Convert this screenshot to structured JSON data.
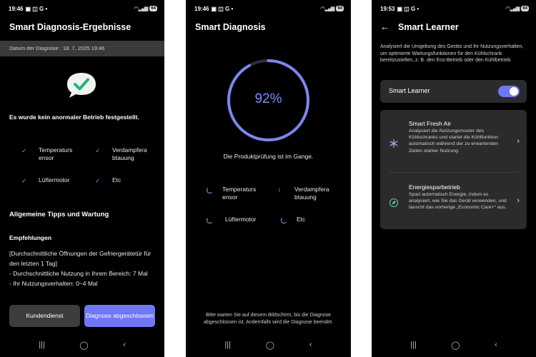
{
  "status": {
    "phone1_time": "19:46",
    "phone2_time": "19:46",
    "phone3_time": "19:53",
    "battery": "64"
  },
  "phone1": {
    "title": "Smart Diagnosis-Ergebnisse",
    "date_line": "Datum der Diagnose : 18. 7. 2025 19:46",
    "status_text": "Es wurde kein anormaler Betrieb festgestellt.",
    "checks": [
      "Temperaturs ensor",
      "Verdampfera btauung",
      "Lüftermotor",
      "Etc"
    ],
    "tips_heading": "Allgemeine Tipps und Wartung",
    "recommendations_heading": "Empfehlungen",
    "body_lines": [
      "[Durchschnittliche Öffnungen der Gefriergerätetür für den letzten 1 Tag]",
      "- Durchschnittliche Nutzung in Ihrem Bereich: 7 Mal",
      "- Ihr Nutzungsverhalten: 0~4 Mal"
    ],
    "btn_service": "Kundendienst",
    "btn_done": "Diagnose abgeschlossen"
  },
  "phone2": {
    "title": "Smart Diagnosis",
    "progress_label": "92%",
    "progress": 0.92,
    "status_text": "Die Produktprüfung ist im Gange.",
    "items": [
      "Temperaturs ensor",
      "Verdampfera btauung",
      "Lüftermotor",
      "Etc"
    ],
    "note": "Bitte warten Sie auf diesem Bildschirm, bis die Diagnose abgeschlossen ist. Andernfalls wird die Diagnose beendet."
  },
  "phone3": {
    "title": "Smart Learner",
    "description": "Analysiert die Umgebung des Geräts und Ihr Nutzungsverhalten, um optimierte Wartungsfunktionen für den Kühlschrank bereitzustellen, z. B. den Eco-Betrieb oder den Kühlbetrieb.",
    "toggle_label": "Smart Learner",
    "toggle_on": true,
    "items": [
      {
        "name": "Smart Fresh Air",
        "desc": "Analysiert die Nutzungsmuster des Kühlschranks und startet die Kühlfunktion automatisch während der zu erwartenden Zeiten starker Nutzung.",
        "icon": "snowflake-icon"
      },
      {
        "name": "Energiesparbetrieb",
        "desc": "Spart automatisch Energie, indem es analysiert, wie Sie das Gerät verwenden, und tauscht das vorherige „Economic Care+“ aus.",
        "icon": "eco-leaf-icon"
      }
    ]
  },
  "colors": {
    "accent": "#6f77f5",
    "check": "#7b8cff",
    "background": "#000000",
    "card": "#2b2b2e"
  }
}
